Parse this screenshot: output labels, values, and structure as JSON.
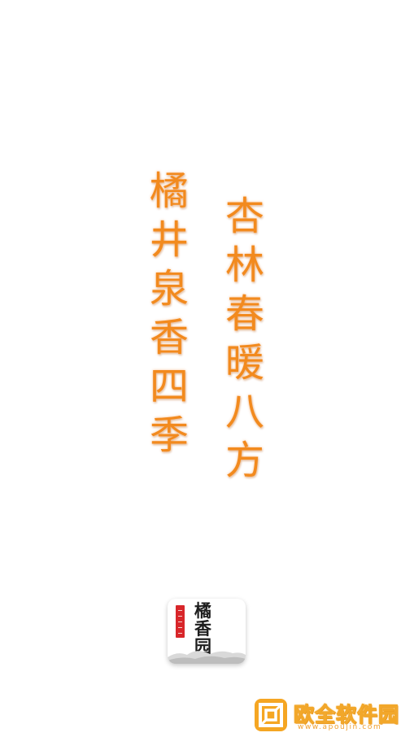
{
  "splash": {
    "poem_right": [
      "杏",
      "林",
      "春",
      "暖",
      "八",
      "方"
    ],
    "poem_left": [
      "橘",
      "井",
      "泉",
      "香",
      "四",
      "季"
    ],
    "accent_color": "#f28a1e"
  },
  "app_logo": {
    "title_chars": [
      "橘",
      "香",
      "园"
    ],
    "seal_color": "#d8262a"
  },
  "watermark": {
    "title": "欧全软件园",
    "url": "www.apoujin.com",
    "color": "#f2a72a"
  }
}
